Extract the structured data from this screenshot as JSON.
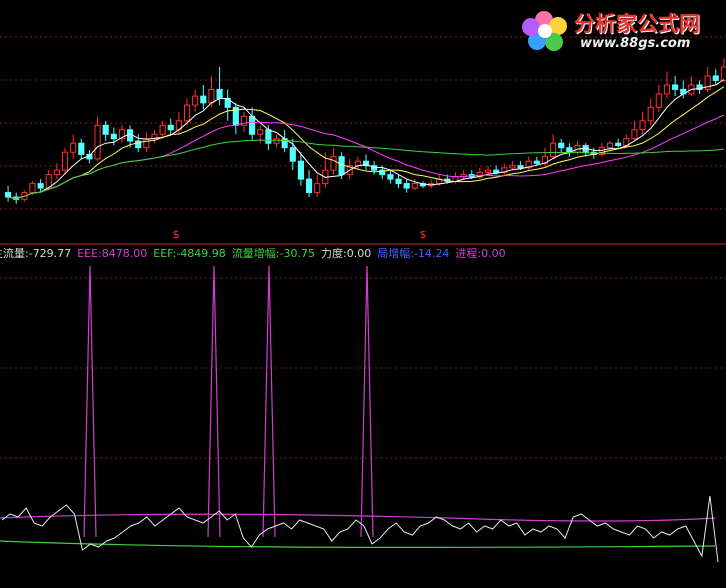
{
  "logo": {
    "title": "分析家公式网",
    "url": "www.88gs.com"
  },
  "markers": {
    "symbol": "$",
    "color": "#ff3030"
  },
  "indicator_bar": {
    "items": [
      {
        "label": "主流量",
        "value": "-729.77",
        "color": "#d8d8d8",
        "label_color": "#d8d8d8"
      },
      {
        "label": "EEE",
        "value": "8478.00",
        "color": "#d040d0",
        "label_color": "#d040d0"
      },
      {
        "label": "EEF",
        "value": "-4849.98",
        "color": "#40d040",
        "label_color": "#40d040"
      },
      {
        "label": "流量增幅",
        "value": "-30.75",
        "color": "#40d040",
        "label_color": "#40d040"
      },
      {
        "label": "力度",
        "value": "0.00",
        "color": "#d8d8d8",
        "label_color": "#d8d8d8"
      },
      {
        "label": "局增幅",
        "value": "-14.24",
        "color": "#4060ff",
        "label_color": "#4060ff"
      },
      {
        "label": "进程",
        "value": "0.00",
        "color": "#d040d0",
        "label_color": "#d040d0"
      }
    ]
  },
  "colors": {
    "up_candle": "#ff3030",
    "down_candle": "#54ffff",
    "ma_short": "#ffffff",
    "ma_mid": "#ffff60",
    "ma_long": "#ff40ff",
    "ma_longest": "#40d040",
    "grid": "#8a1c1c",
    "separator": "#d02020",
    "spike": "#d040d0",
    "flow_line": "#e8e8e8",
    "flow_upper": "#d040d0",
    "flow_lower": "#40d040"
  },
  "chart_data": [
    {
      "type": "candlestick",
      "description_source": "price panel",
      "series": [
        {
          "name": "k",
          "values": [
            [
              40,
              38,
              43,
              36
            ],
            [
              38,
              37,
              40,
              35
            ],
            [
              37,
              40,
              41,
              36
            ],
            [
              40,
              44,
              45,
              39
            ],
            [
              44,
              42,
              46,
              40
            ],
            [
              42,
              48,
              50,
              41
            ],
            [
              48,
              50,
              53,
              46
            ],
            [
              50,
              58,
              60,
              48
            ],
            [
              58,
              62,
              66,
              55
            ],
            [
              62,
              57,
              64,
              55
            ],
            [
              57,
              55,
              59,
              53
            ],
            [
              55,
              70,
              74,
              54
            ],
            [
              70,
              66,
              72,
              63
            ],
            [
              66,
              64,
              69,
              61
            ],
            [
              64,
              68,
              70,
              62
            ],
            [
              68,
              63,
              70,
              60
            ],
            [
              63,
              60,
              66,
              58
            ],
            [
              60,
              64,
              67,
              58
            ],
            [
              64,
              66,
              68,
              62
            ],
            [
              66,
              70,
              72,
              64
            ],
            [
              70,
              68,
              73,
              66
            ],
            [
              68,
              72,
              76,
              66
            ],
            [
              72,
              79,
              82,
              70
            ],
            [
              79,
              83,
              86,
              76
            ],
            [
              83,
              80,
              88,
              77
            ],
            [
              80,
              86,
              92,
              78
            ],
            [
              86,
              82,
              96,
              79
            ],
            [
              82,
              78,
              86,
              72
            ],
            [
              78,
              70,
              80,
              66
            ],
            [
              70,
              74,
              76,
              67
            ],
            [
              74,
              66,
              78,
              63
            ],
            [
              66,
              68,
              70,
              62
            ],
            [
              68,
              62,
              70,
              59
            ],
            [
              62,
              64,
              66,
              60
            ],
            [
              64,
              60,
              68,
              58
            ],
            [
              60,
              54,
              64,
              50
            ],
            [
              54,
              46,
              58,
              43
            ],
            [
              46,
              40,
              50,
              38
            ],
            [
              40,
              44,
              48,
              38
            ],
            [
              44,
              50,
              58,
              42
            ],
            [
              50,
              56,
              60,
              48
            ],
            [
              56,
              48,
              58,
              46
            ],
            [
              48,
              52,
              55,
              46
            ],
            [
              52,
              54,
              56,
              50
            ],
            [
              54,
              52,
              57,
              50
            ],
            [
              52,
              50,
              54,
              48
            ],
            [
              50,
              48,
              52,
              46
            ],
            [
              48,
              46,
              50,
              44
            ],
            [
              46,
              44,
              48,
              42
            ],
            [
              44,
              42,
              46,
              40
            ],
            [
              42,
              44,
              46,
              41
            ],
            [
              44,
              43,
              45,
              42
            ],
            [
              43,
              44,
              46,
              42
            ],
            [
              44,
              46,
              48,
              43
            ],
            [
              46,
              45,
              48,
              44
            ],
            [
              45,
              47,
              49,
              44
            ],
            [
              47,
              48,
              50,
              46
            ],
            [
              48,
              47,
              50,
              46
            ],
            [
              47,
              49,
              51,
              46
            ],
            [
              49,
              50,
              52,
              48
            ],
            [
              50,
              49,
              52,
              48
            ],
            [
              49,
              51,
              53,
              48
            ],
            [
              51,
              52,
              54,
              50
            ],
            [
              52,
              51,
              54,
              50
            ],
            [
              51,
              54,
              56,
              50
            ],
            [
              54,
              53,
              56,
              52
            ],
            [
              53,
              56,
              60,
              52
            ],
            [
              56,
              62,
              66,
              55
            ],
            [
              62,
              60,
              64,
              58
            ],
            [
              60,
              58,
              62,
              56
            ],
            [
              58,
              61,
              63,
              57
            ],
            [
              61,
              58,
              62,
              56
            ],
            [
              58,
              57,
              60,
              55
            ],
            [
              57,
              60,
              62,
              56
            ],
            [
              60,
              62,
              63,
              59
            ],
            [
              62,
              61,
              64,
              60
            ],
            [
              61,
              64,
              66,
              60
            ],
            [
              64,
              68,
              72,
              63
            ],
            [
              68,
              72,
              76,
              66
            ],
            [
              72,
              78,
              82,
              70
            ],
            [
              78,
              84,
              88,
              76
            ],
            [
              84,
              88,
              94,
              82
            ],
            [
              88,
              86,
              92,
              83
            ],
            [
              86,
              84,
              90,
              82
            ],
            [
              84,
              88,
              92,
              83
            ],
            [
              88,
              86,
              90,
              84
            ],
            [
              86,
              92,
              96,
              85
            ],
            [
              92,
              90,
              95,
              88
            ],
            [
              90,
              96,
              100,
              89
            ]
          ]
        }
      ]
    },
    {
      "type": "line",
      "description_source": "indicator panel",
      "series": [
        {
          "name": "主流量",
          "values": [
            4,
            6,
            5,
            8,
            3,
            2,
            5,
            7,
            9,
            6,
            -6,
            -4,
            -5,
            -3,
            -2,
            0,
            2,
            3,
            5,
            2,
            4,
            6,
            8,
            5,
            4,
            3,
            5,
            7,
            4,
            6,
            -2,
            -5,
            -1,
            1,
            2,
            3,
            1,
            4,
            3,
            2,
            1,
            -3,
            0,
            1,
            4,
            2,
            -4,
            -2,
            1,
            3,
            0,
            -1,
            2,
            3,
            5,
            4,
            2,
            1,
            3,
            0,
            2,
            1,
            4,
            2,
            3,
            -1,
            1,
            0,
            2,
            1,
            -2,
            5,
            6,
            4,
            2,
            3,
            1,
            0,
            -1,
            2,
            1,
            -2,
            0,
            -1,
            1,
            2,
            -3,
            -8,
            12,
            -10
          ]
        },
        {
          "name": "EEE",
          "values": [
            0,
            0,
            0,
            0,
            0,
            0,
            0,
            0,
            0,
            0,
            0,
            0,
            0,
            0,
            0,
            0,
            0,
            0,
            0,
            0,
            0,
            0,
            0,
            0,
            0,
            0,
            0,
            0,
            0,
            0,
            0,
            0,
            0,
            0,
            0,
            0,
            0,
            0,
            0,
            0,
            0,
            0,
            0,
            0,
            0,
            0,
            0,
            0,
            0,
            0,
            0,
            0,
            0,
            0,
            0,
            0,
            0,
            0,
            0,
            0,
            0,
            0,
            0,
            0,
            0,
            0,
            0,
            0,
            0,
            0,
            0,
            0,
            0,
            0,
            0,
            0,
            0,
            0,
            0,
            0,
            0,
            0,
            0,
            0,
            0,
            0,
            0,
            0,
            0,
            0
          ]
        }
      ]
    }
  ]
}
